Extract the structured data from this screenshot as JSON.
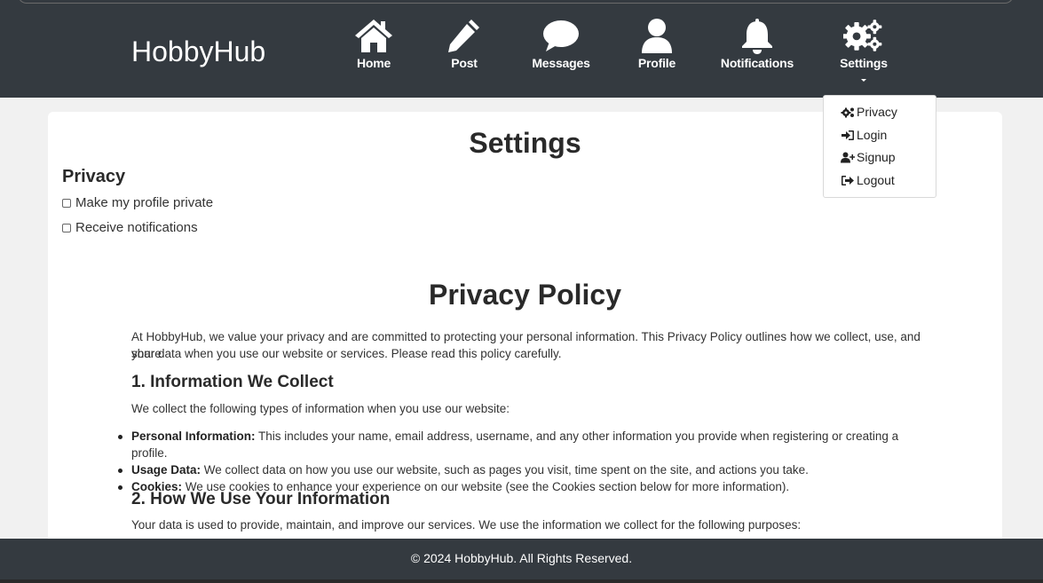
{
  "brand": "HobbyHub",
  "nav": {
    "home": "Home",
    "post": "Post",
    "messages": "Messages",
    "profile": "Profile",
    "notifications": "Notifications",
    "settings": "Settings"
  },
  "dropdown": {
    "privacy": "Privacy",
    "login": "Login",
    "signup": "Signup",
    "logout": "Logout"
  },
  "page": {
    "title": "Settings",
    "privacy_heading": "Privacy",
    "options": [
      "Make my profile private",
      "Receive notifications"
    ]
  },
  "policy": {
    "title": "Privacy Policy",
    "intro_line1": "At HobbyHub, we value your privacy and are committed to protecting your personal information. This Privacy Policy outlines how we collect, use, and share",
    "intro_line2": "your data when you use our website or services. Please read this policy carefully.",
    "s1_heading": "1. Information We Collect",
    "s1_text": "We collect the following types of information when you use our website:",
    "items": [
      {
        "term": "Personal Information:",
        "desc": " This includes your name, email address, username, and any other information you provide when registering or creating a profile."
      },
      {
        "term": "Usage Data:",
        "desc": " We collect data on how you use our website, such as pages you visit, time spent on the site, and actions you take."
      },
      {
        "term": "Cookies:",
        "desc": " We use cookies to enhance your experience on our website (see the Cookies section below for more information)."
      }
    ],
    "s2_heading": "2. How We Use Your Information",
    "s2_text": "Your data is used to provide, maintain, and improve our services. We use the information we collect for the following purposes:"
  },
  "footer": "© 2024 HobbyHub. All Rights Reserved.",
  "colors": {
    "header_bg": "#343a40",
    "page_bg": "#f1f1f1"
  }
}
